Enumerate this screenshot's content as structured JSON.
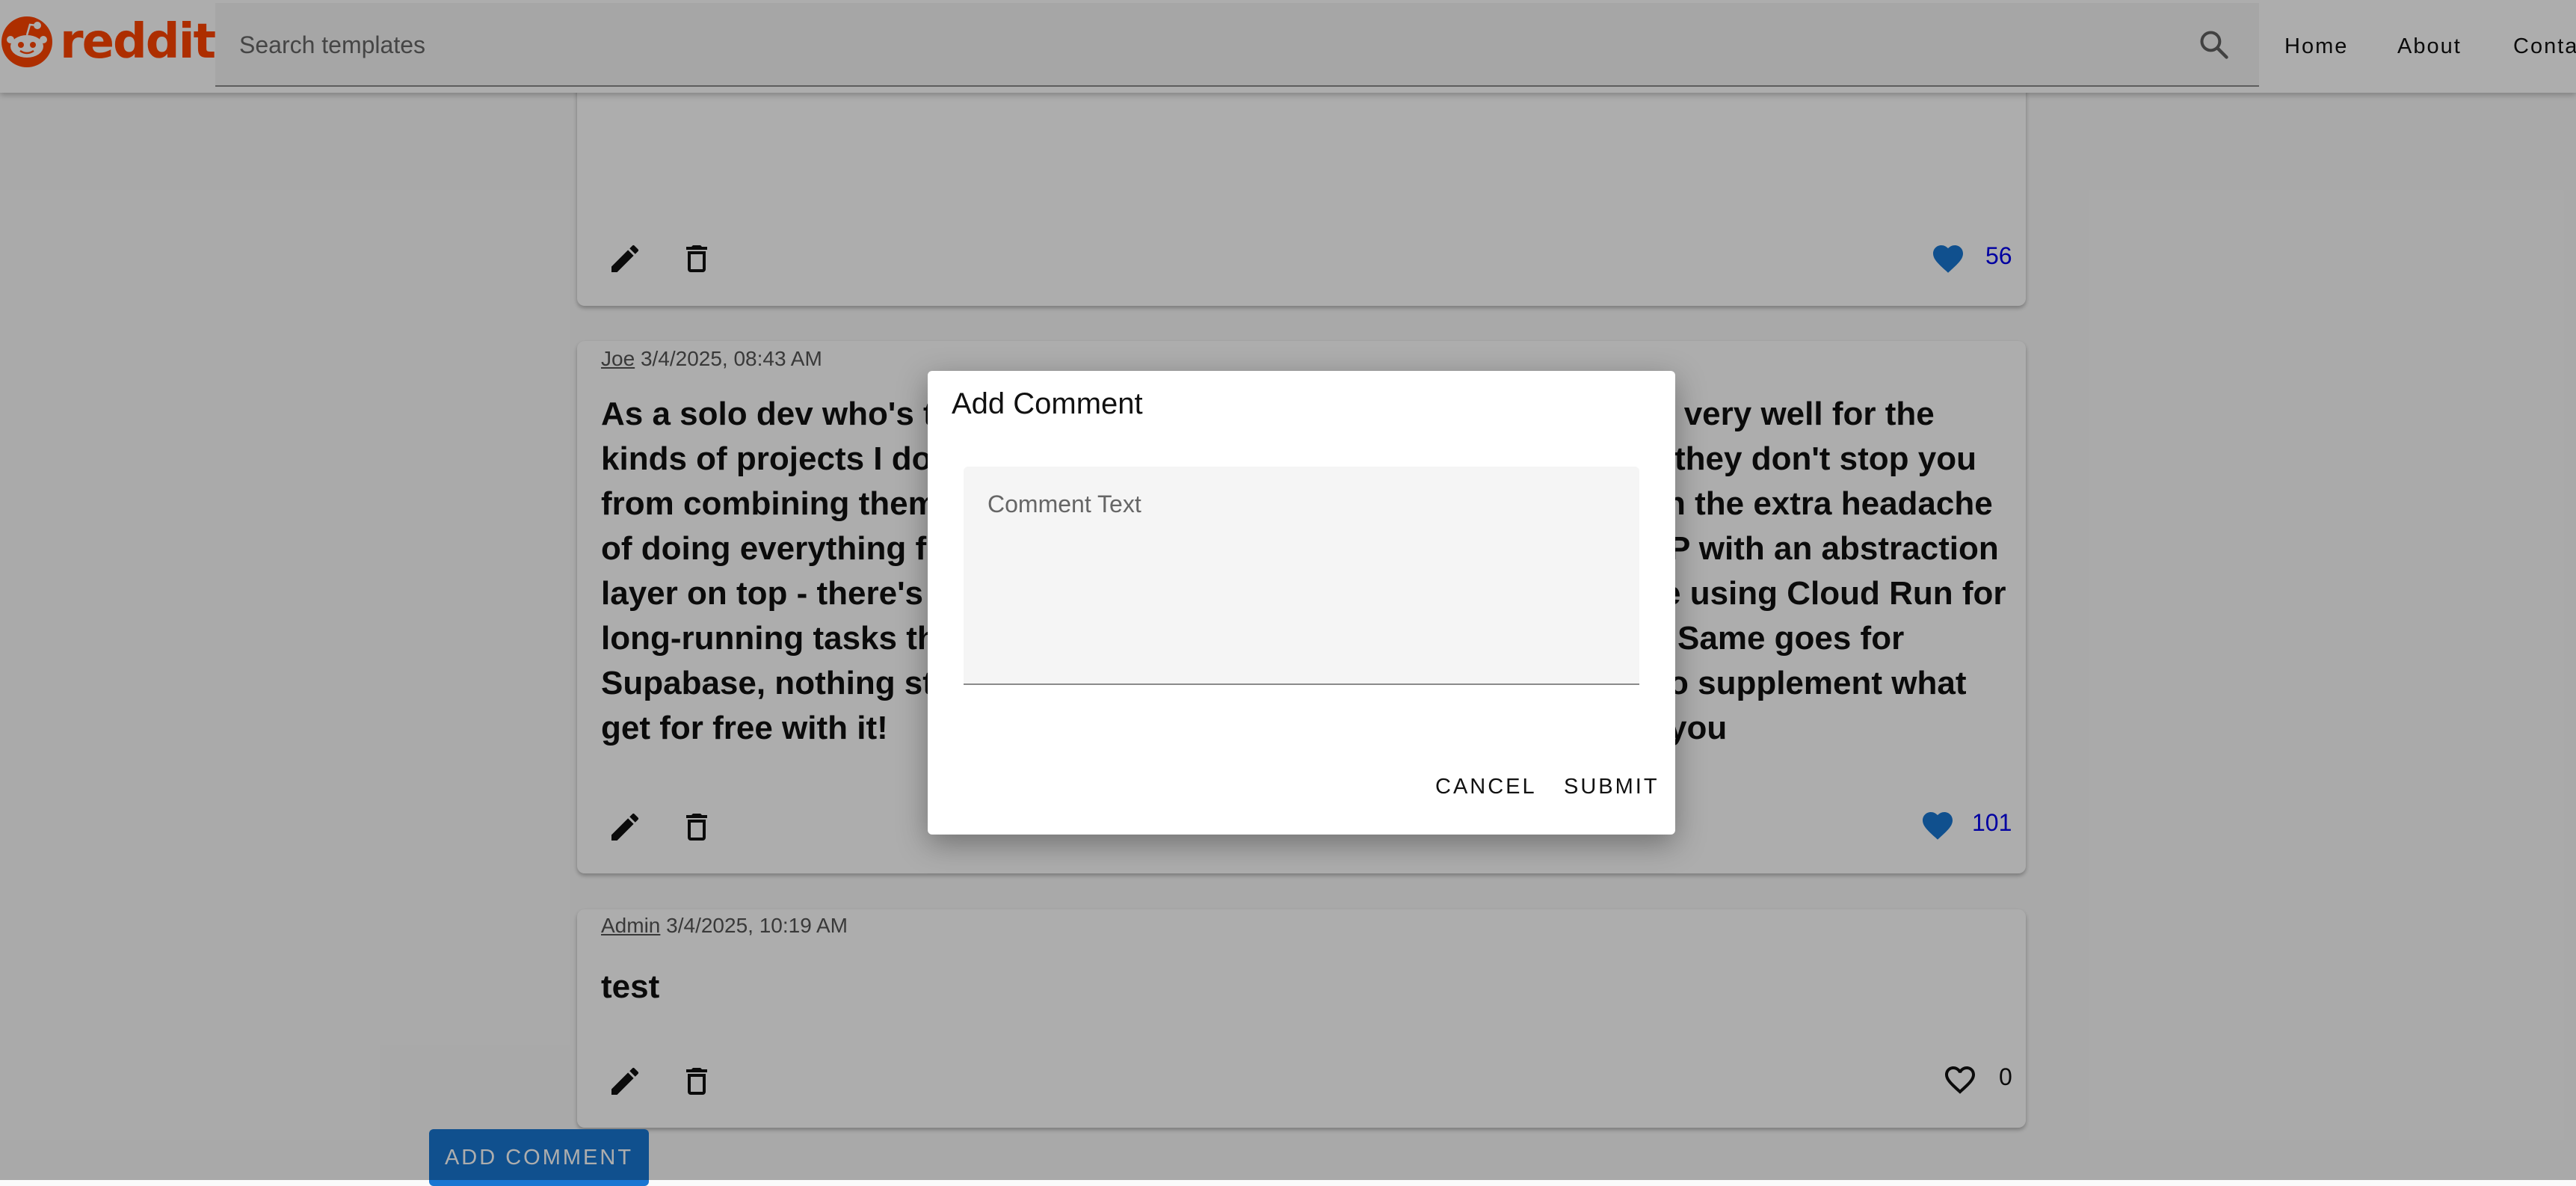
{
  "header": {
    "logo_text": "reddit",
    "search_placeholder": "Search templates",
    "nav": [
      "Home",
      "About",
      "Conta"
    ]
  },
  "posts": [
    {
      "likes": "56",
      "liked": true
    },
    {
      "author": "Joe",
      "timestamp": "3/4/2025, 08:43 AM",
      "body": "As a solo dev who's tak…k very well for the kinds of projects I do f…they don't stop you from combining them w…n the extra headache of doing everything fro…P with an abstraction layer on top - there's n…e using Cloud Run for long-running tasks tha… Same goes for Supabase, nothing stop… supplement what you get for free with it!",
      "lines": [
        "As a solo dev who's tak",
        "kinds of projects I do f",
        "from combining them w",
        "of doing everything fro",
        "layer on top - there's n",
        "long-running tasks tha",
        "Supabase, nothing stop",
        "get for free with it!"
      ],
      "lines_right": [
        "k very well for the",
        "they don't stop you",
        "n the extra headache",
        "P with an abstraction",
        "e using Cloud Run for",
        "Same goes for",
        "o supplement what you",
        ""
      ],
      "likes": "101",
      "liked": true
    },
    {
      "author": "Admin",
      "timestamp": "3/4/2025, 10:19 AM",
      "body": "test",
      "likes": "0",
      "liked": false
    }
  ],
  "add_comment_label": "ADD COMMENT",
  "dialog": {
    "title": "Add Comment",
    "field_placeholder": "Comment Text",
    "cancel_label": "CANCEL",
    "submit_label": "SUBMIT"
  },
  "colors": {
    "brand": "#ff4500",
    "primary": "#1976d2",
    "like_active": "#1976d2",
    "like_count": "#0000ee"
  }
}
